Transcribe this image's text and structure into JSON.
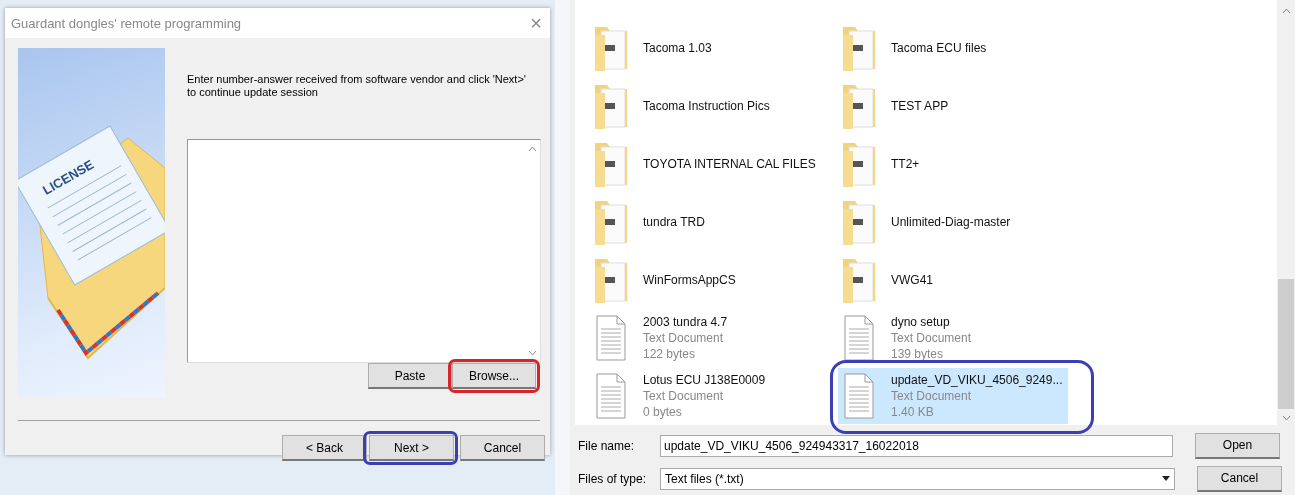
{
  "wizard": {
    "title": "Guardant dongles' remote programming",
    "close": "×",
    "picture_label": "LICENSE",
    "instruction": "Enter number-answer received from software vendor and click 'Next>' to continue update session",
    "answer_buttons": [
      {
        "label": "Paste",
        "circled": false
      },
      {
        "label": "Browse...",
        "circled": true,
        "color": "#d9232a"
      }
    ],
    "nav_buttons": [
      {
        "label": "< Back",
        "circled": false
      },
      {
        "label": "Next >",
        "circled": true,
        "color": "#3b3fb5"
      },
      {
        "label": "Cancel",
        "circled": false
      }
    ]
  },
  "file_dialog": {
    "items": [
      {
        "kind": "folder",
        "name": "Tacoma 1.03",
        "selected": false,
        "circled": false
      },
      {
        "kind": "folder",
        "name": "Tacoma ECU files",
        "selected": false,
        "circled": false
      },
      {
        "kind": "folder",
        "name": "Tacoma Instruction Pics",
        "selected": false,
        "circled": false
      },
      {
        "kind": "folder",
        "name": "TEST APP",
        "selected": false,
        "circled": false
      },
      {
        "kind": "folder",
        "name": "TOYOTA INTERNAL CAL FILES",
        "selected": false,
        "circled": false
      },
      {
        "kind": "folder",
        "name": "TT2+",
        "selected": false,
        "circled": false
      },
      {
        "kind": "folder",
        "name": "tundra TRD",
        "selected": false,
        "circled": false
      },
      {
        "kind": "folder",
        "name": "Unlimited-Diag-master",
        "selected": false,
        "circled": false
      },
      {
        "kind": "folder",
        "name": "WinFormsAppCS",
        "selected": false,
        "circled": false
      },
      {
        "kind": "folder",
        "name": "VWG41",
        "selected": false,
        "circled": false
      },
      {
        "kind": "document",
        "name": "2003 tundra 4.7",
        "type": "Text Document",
        "size": "122 bytes",
        "selected": false,
        "circled": false
      },
      {
        "kind": "document",
        "name": "dyno setup",
        "type": "Text Document",
        "size": "139 bytes",
        "selected": false,
        "circled": false
      },
      {
        "kind": "document",
        "name": "Lotus ECU J138E0009",
        "type": "Text Document",
        "size": "0 bytes",
        "selected": false,
        "circled": false
      },
      {
        "kind": "document",
        "name": "update_VD_VIKU_4506_9249...",
        "type": "Text Document",
        "size": "1.40 KB",
        "selected": true,
        "circled": true,
        "color": "#3b3fb5"
      }
    ],
    "file_name_label": "File name:",
    "file_name": "update_VD_VIKU_4506_924943317_16022018",
    "file_type_label": "Files of type:",
    "file_type": "Text files (*.txt)",
    "buttons": [
      "Open",
      "Cancel"
    ]
  }
}
